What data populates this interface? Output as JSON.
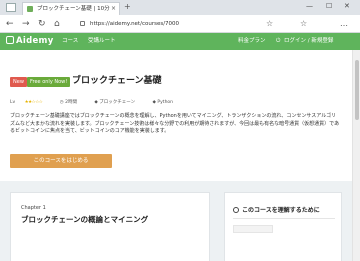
{
  "browser": {
    "tab_title": "ブロックチェーン基礎 | 10分",
    "tab_close": "×",
    "new_tab": "+",
    "url": "https://aidemy.net/courses/7000",
    "controls": {
      "minimize": "—",
      "maximize": "☐",
      "close": "✕"
    },
    "nav": {
      "back": "←",
      "forward": "→",
      "reload": "↻",
      "home": "⌂"
    },
    "tools": {
      "reading": "☆",
      "favorites": "☆",
      "menu": "…"
    }
  },
  "site": {
    "logo": "Aidemy",
    "nav": [
      "コース",
      "受講ルート"
    ],
    "pricing": "料金プラン",
    "login": "ログイン / 新規登録",
    "brand_color": "#5fb45c"
  },
  "course": {
    "badges": {
      "new": "New",
      "free": "Free only Now!"
    },
    "title": "ブロックチェーン基礎",
    "level_label": "Lv",
    "stars": "★★☆☆☆",
    "duration": "2時間",
    "tags": [
      "ブロックチェーン",
      "Python"
    ],
    "description": "ブロックチェーン基礎講座ではブロックチェーンの概念を理解し、Pythonを用いてマイニング、トランザクションの流れ、コンセンサスアルゴリズムなど大まかな流れを実装します。ブロックチェーン技術は様々な分野での利用が期待されますが、今回は最も有名な暗号通貨（仮想通貨）であるビットコインに焦点を当て、ビットコインのコア機能を実装します。",
    "cta": "このコースをはじめる",
    "cta_color": "#e0a050"
  },
  "chapter": {
    "label": "Chapter 1",
    "title": "ブロックチェーンの概論とマイニング"
  },
  "sidebar": {
    "heading": "このコースを理解するために"
  }
}
